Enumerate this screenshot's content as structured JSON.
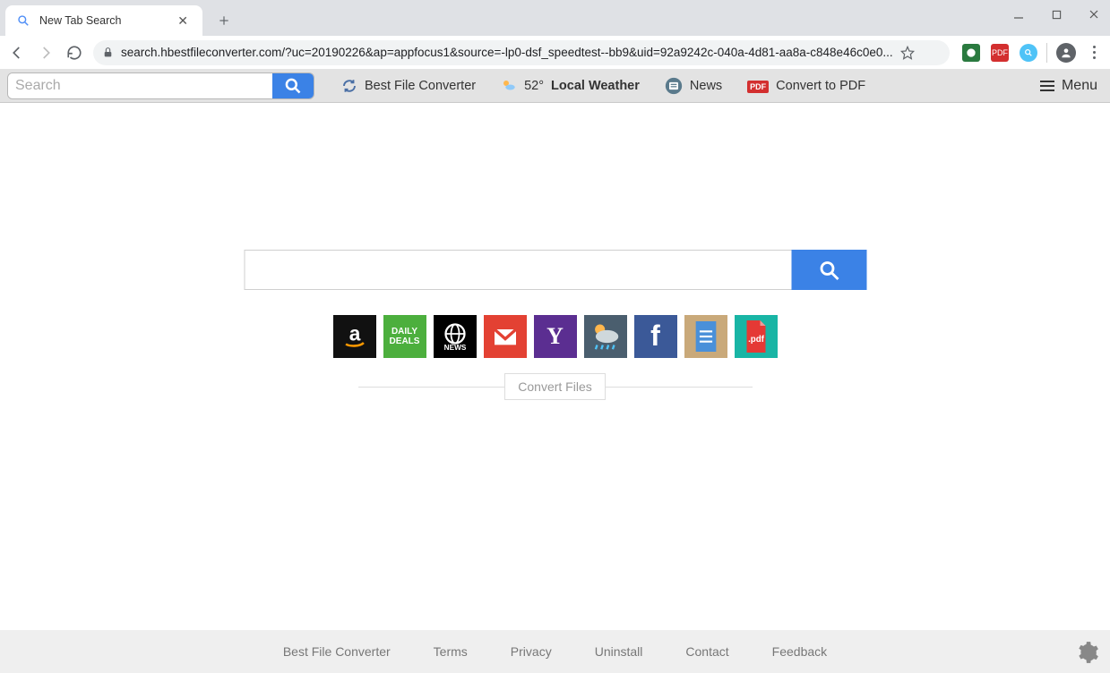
{
  "browser": {
    "tab_title": "New Tab Search",
    "url": "search.hbestfileconverter.com/?uc=20190226&ap=appfocus1&source=-lp0-dsf_speedtest--bb9&uid=92a9242c-040a-4d81-aa8a-c848e46c0e0..."
  },
  "toolbar": {
    "search_placeholder": "Search",
    "links": {
      "bfc": "Best File Converter",
      "weather_temp": "52°",
      "weather_label": "Local Weather",
      "news": "News",
      "pdf": "Convert to PDF"
    },
    "menu_label": "Menu"
  },
  "main": {
    "convert_label": "Convert Files",
    "tiles": [
      {
        "name": "amazon",
        "bg": "#111",
        "label": "a"
      },
      {
        "name": "daily-deals",
        "bg": "#4caf3d",
        "label": "DAILY DEALS"
      },
      {
        "name": "news",
        "bg": "#000",
        "label": "NEWS"
      },
      {
        "name": "gmail",
        "bg": "#e34133",
        "label": "M"
      },
      {
        "name": "yahoo",
        "bg": "#5b2e91",
        "label": "Y"
      },
      {
        "name": "weather",
        "bg": "#4a5e6e",
        "label": ""
      },
      {
        "name": "facebook",
        "bg": "#3b5998",
        "label": "f"
      },
      {
        "name": "docs",
        "bg": "#c9a97a",
        "label": ""
      },
      {
        "name": "pdf",
        "bg": "#e53935",
        "label": ".pdf"
      }
    ]
  },
  "footer": {
    "links": [
      "Best File Converter",
      "Terms",
      "Privacy",
      "Uninstall",
      "Contact",
      "Feedback"
    ]
  },
  "icons": {
    "pdf_badge": "PDF"
  }
}
